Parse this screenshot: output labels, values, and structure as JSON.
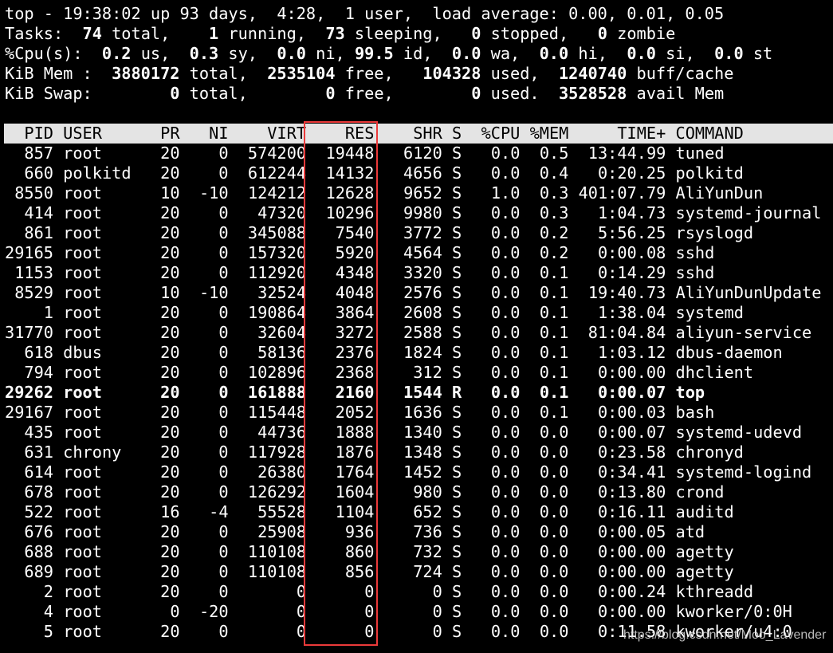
{
  "summary": [
    [
      {
        "t": "top - 19:38:02 up 93 days,  4:28,  1 user,  load average: 0.00, 0.01, 0.05",
        "b": false
      }
    ],
    [
      {
        "t": "Tasks: ",
        "b": false
      },
      {
        "t": " 74",
        "b": true
      },
      {
        "t": " total,   ",
        "b": false
      },
      {
        "t": " 1",
        "b": true
      },
      {
        "t": " running,  ",
        "b": false
      },
      {
        "t": "73",
        "b": true
      },
      {
        "t": " sleeping,   ",
        "b": false
      },
      {
        "t": "0",
        "b": true
      },
      {
        "t": " stopped,   ",
        "b": false
      },
      {
        "t": "0",
        "b": true
      },
      {
        "t": " zombie",
        "b": false
      }
    ],
    [
      {
        "t": "%Cpu(s):  ",
        "b": false
      },
      {
        "t": "0.2",
        "b": true
      },
      {
        "t": " us,  ",
        "b": false
      },
      {
        "t": "0.3",
        "b": true
      },
      {
        "t": " sy,  ",
        "b": false
      },
      {
        "t": "0.0",
        "b": true
      },
      {
        "t": " ni, ",
        "b": false
      },
      {
        "t": "99.5",
        "b": true
      },
      {
        "t": " id,  ",
        "b": false
      },
      {
        "t": "0.0",
        "b": true
      },
      {
        "t": " wa,  ",
        "b": false
      },
      {
        "t": "0.0",
        "b": true
      },
      {
        "t": " hi,  ",
        "b": false
      },
      {
        "t": "0.0",
        "b": true
      },
      {
        "t": " si,  ",
        "b": false
      },
      {
        "t": "0.0",
        "b": true
      },
      {
        "t": " st",
        "b": false
      }
    ],
    [
      {
        "t": "KiB Mem :  ",
        "b": false
      },
      {
        "t": "3880172",
        "b": true
      },
      {
        "t": " total,  ",
        "b": false
      },
      {
        "t": "2535104",
        "b": true
      },
      {
        "t": " free,   ",
        "b": false
      },
      {
        "t": "104328",
        "b": true
      },
      {
        "t": " used,  ",
        "b": false
      },
      {
        "t": "1240740",
        "b": true
      },
      {
        "t": " buff/cache",
        "b": false
      }
    ],
    [
      {
        "t": "KiB Swap:        ",
        "b": false
      },
      {
        "t": "0",
        "b": true
      },
      {
        "t": " total,        ",
        "b": false
      },
      {
        "t": "0",
        "b": true
      },
      {
        "t": " free,        ",
        "b": false
      },
      {
        "t": "0",
        "b": true
      },
      {
        "t": " used.  ",
        "b": false
      },
      {
        "t": "3528528",
        "b": true
      },
      {
        "t": " avail Mem",
        "b": false
      }
    ]
  ],
  "columns": [
    "PID",
    "USER",
    "PR",
    "NI",
    "VIRT",
    "RES",
    "SHR",
    "S",
    "%CPU",
    "%MEM",
    "TIME+",
    "COMMAND"
  ],
  "processes": [
    [
      "857",
      "root",
      "20",
      "0",
      "574200",
      "19448",
      "6120",
      "S",
      "0.0",
      "0.5",
      "13:44.99",
      "tuned"
    ],
    [
      "660",
      "polkitd",
      "20",
      "0",
      "612244",
      "14132",
      "4656",
      "S",
      "0.0",
      "0.4",
      "0:20.25",
      "polkitd"
    ],
    [
      "8550",
      "root",
      "10",
      "-10",
      "124212",
      "12628",
      "9652",
      "S",
      "1.0",
      "0.3",
      "401:07.79",
      "AliYunDun"
    ],
    [
      "414",
      "root",
      "20",
      "0",
      "47320",
      "10296",
      "9980",
      "S",
      "0.0",
      "0.3",
      "1:04.73",
      "systemd-journal"
    ],
    [
      "861",
      "root",
      "20",
      "0",
      "345088",
      "7540",
      "3772",
      "S",
      "0.0",
      "0.2",
      "5:56.25",
      "rsyslogd"
    ],
    [
      "29165",
      "root",
      "20",
      "0",
      "157320",
      "5920",
      "4564",
      "S",
      "0.0",
      "0.2",
      "0:00.08",
      "sshd"
    ],
    [
      "1153",
      "root",
      "20",
      "0",
      "112920",
      "4348",
      "3320",
      "S",
      "0.0",
      "0.1",
      "0:14.29",
      "sshd"
    ],
    [
      "8529",
      "root",
      "10",
      "-10",
      "32524",
      "4048",
      "2576",
      "S",
      "0.0",
      "0.1",
      "19:40.73",
      "AliYunDunUpdate"
    ],
    [
      "1",
      "root",
      "20",
      "0",
      "190864",
      "3864",
      "2608",
      "S",
      "0.0",
      "0.1",
      "1:38.04",
      "systemd"
    ],
    [
      "31770",
      "root",
      "20",
      "0",
      "32604",
      "3272",
      "2588",
      "S",
      "0.0",
      "0.1",
      "81:04.84",
      "aliyun-service"
    ],
    [
      "618",
      "dbus",
      "20",
      "0",
      "58136",
      "2376",
      "1824",
      "S",
      "0.0",
      "0.1",
      "1:03.12",
      "dbus-daemon"
    ],
    [
      "794",
      "root",
      "20",
      "0",
      "102896",
      "2368",
      "312",
      "S",
      "0.0",
      "0.1",
      "0:00.00",
      "dhclient"
    ],
    [
      "29262",
      "root",
      "20",
      "0",
      "161888",
      "2160",
      "1544",
      "R",
      "0.0",
      "0.1",
      "0:00.07",
      "top"
    ],
    [
      "29167",
      "root",
      "20",
      "0",
      "115448",
      "2052",
      "1636",
      "S",
      "0.0",
      "0.1",
      "0:00.03",
      "bash"
    ],
    [
      "435",
      "root",
      "20",
      "0",
      "44736",
      "1888",
      "1340",
      "S",
      "0.0",
      "0.0",
      "0:00.07",
      "systemd-udevd"
    ],
    [
      "631",
      "chrony",
      "20",
      "0",
      "117928",
      "1876",
      "1348",
      "S",
      "0.0",
      "0.0",
      "0:23.58",
      "chronyd"
    ],
    [
      "614",
      "root",
      "20",
      "0",
      "26380",
      "1764",
      "1452",
      "S",
      "0.0",
      "0.0",
      "0:34.41",
      "systemd-logind"
    ],
    [
      "678",
      "root",
      "20",
      "0",
      "126292",
      "1604",
      "980",
      "S",
      "0.0",
      "0.0",
      "0:13.80",
      "crond"
    ],
    [
      "522",
      "root",
      "16",
      "-4",
      "55528",
      "1104",
      "652",
      "S",
      "0.0",
      "0.0",
      "0:16.11",
      "auditd"
    ],
    [
      "676",
      "root",
      "20",
      "0",
      "25908",
      "936",
      "736",
      "S",
      "0.0",
      "0.0",
      "0:00.05",
      "atd"
    ],
    [
      "688",
      "root",
      "20",
      "0",
      "110108",
      "860",
      "732",
      "S",
      "0.0",
      "0.0",
      "0:00.00",
      "agetty"
    ],
    [
      "689",
      "root",
      "20",
      "0",
      "110108",
      "856",
      "724",
      "S",
      "0.0",
      "0.0",
      "0:00.00",
      "agetty"
    ],
    [
      "2",
      "root",
      "20",
      "0",
      "0",
      "0",
      "0",
      "S",
      "0.0",
      "0.0",
      "0:00.24",
      "kthreadd"
    ],
    [
      "4",
      "root",
      "0",
      "-20",
      "0",
      "0",
      "0",
      "S",
      "0.0",
      "0.0",
      "0:00.00",
      "kworker/0:0H"
    ],
    [
      "5",
      "root",
      "20",
      "0",
      "0",
      "0",
      "0",
      "S",
      "0.0",
      "0.0",
      "0:11.58",
      "kworker/u4:0"
    ]
  ],
  "running_state": "R",
  "highlight_color": "#ec3a3a",
  "watermark": "https://blog.csdn.net/Moo_Lavender"
}
